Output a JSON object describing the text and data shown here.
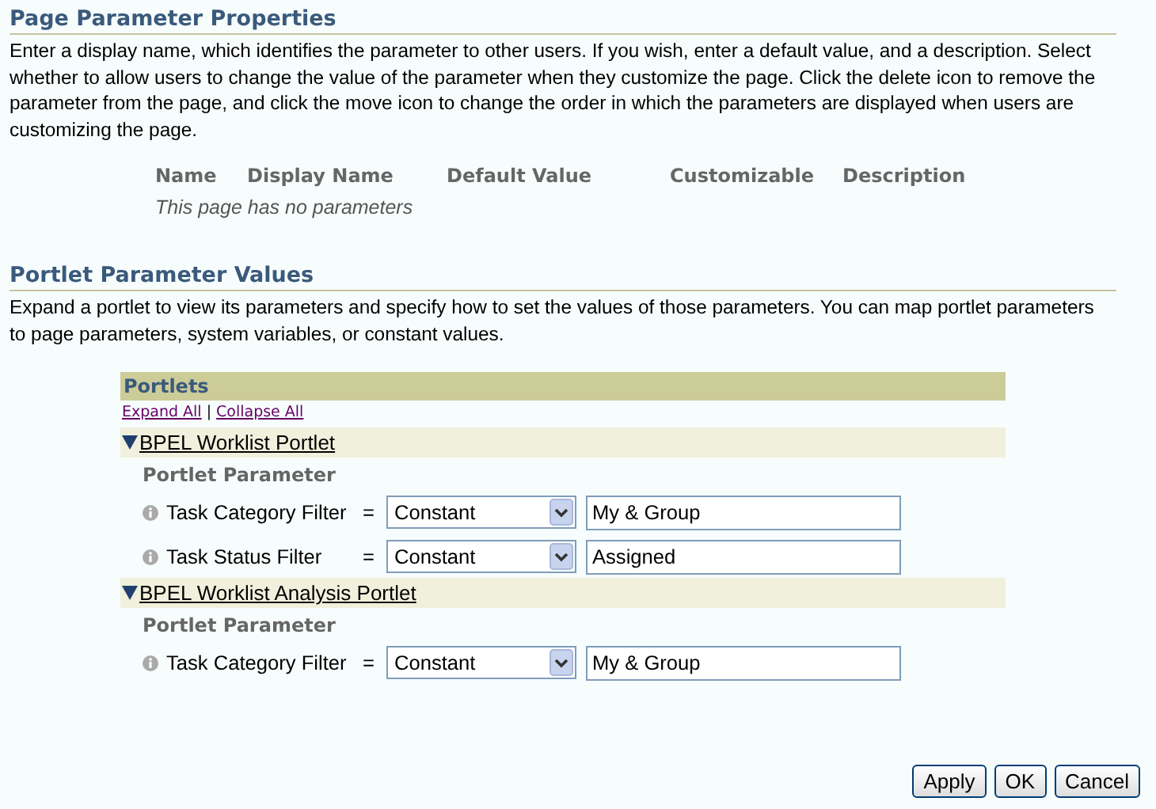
{
  "page_parameters": {
    "title": "Page Parameter Properties",
    "description": "Enter a display name, which identifies the parameter to other users. If you wish, enter a default value, and a description. Select whether to allow users to change the value of the parameter when they customize the page. Click the delete icon to remove the parameter from the page, and click the move icon to change the order in which the parameters are displayed when users are customizing the page.",
    "table": {
      "columns": [
        "Name",
        "Display Name",
        "Default Value",
        "Customizable",
        "Description"
      ],
      "empty_message": "This page has no parameters"
    }
  },
  "portlet_parameters": {
    "title": "Portlet Parameter Values",
    "description": "Expand a portlet to view its parameters and specify how to set the values of those parameters. You can map portlet parameters to page parameters, system variables, or constant values.",
    "panel": {
      "title": "Portlets",
      "links": [
        "Expand All",
        "Collapse All"
      ],
      "separator": "|",
      "portlets": [
        {
          "name": "BPEL Worklist Portlet",
          "expanded": true,
          "section_label": "Portlet Parameter",
          "parameters": [
            {
              "label": "Task Category Filter",
              "operator": "=",
              "source": "Constant",
              "value": "My & Group"
            },
            {
              "label": "Task Status Filter",
              "operator": "=",
              "source": "Constant",
              "value": "Assigned"
            }
          ]
        },
        {
          "name": "BPEL Worklist Analysis Portlet",
          "expanded": true,
          "section_label": "Portlet Parameter",
          "parameters": [
            {
              "label": "Task Category Filter",
              "operator": "=",
              "source": "Constant",
              "value": "My & Group"
            }
          ]
        }
      ]
    }
  },
  "buttons": [
    "Apply",
    "OK",
    "Cancel"
  ]
}
